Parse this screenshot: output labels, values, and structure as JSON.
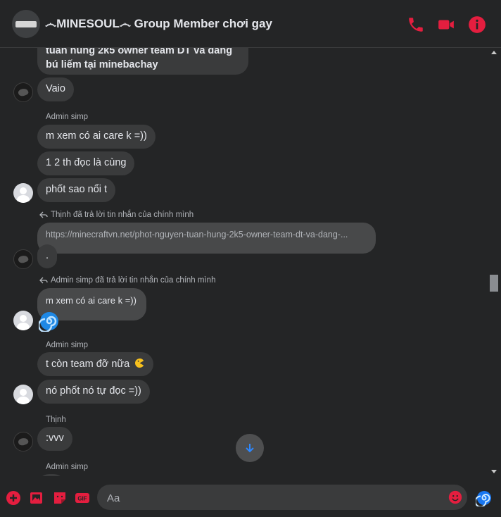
{
  "header": {
    "title": "෴MINESOUL෴ Group Member chơi gay",
    "icons": [
      "phone-icon",
      "video-camera-icon",
      "info-icon"
    ],
    "accent_color": "#e41e3f"
  },
  "messages": {
    "m1_line1": "tuan hung 2k5 owner team DT va dang",
    "m1_line2": "bú liếm tại minebachay",
    "m2": "Vaio",
    "sender_admin1": "Admin simp",
    "m3": "m xem có ai care k =))",
    "m4": "1 2 th đọc là cùng",
    "m5": "phốt sao nổi t",
    "reply1_note": "Thịnh đã trả lời tin nhắn của chính mình",
    "reply1_quoted": "https://minecraftvn.net/phot-nguyen-tuan-hung-2k5-owner-team-dt-va-dang-...",
    "m6": ".",
    "reply2_note": "Admin simp đã trả lời tin nhắn của chính mình",
    "reply2_quoted": "m xem có ai care k =))",
    "sender_admin2": "Admin simp",
    "m7": "t còn team đỡ nữa",
    "m8": "nó phốt nó tự đọc =))",
    "sender_thinh": "Thịnh",
    "m9": ":vvv",
    "sender_admin3": "Admin simp"
  },
  "composer": {
    "placeholder": "Aa"
  },
  "footer_icons": [
    "plus-icon",
    "image-icon",
    "sticker-icon",
    "gif-icon",
    "emoji-icon",
    "spiral-icon"
  ]
}
